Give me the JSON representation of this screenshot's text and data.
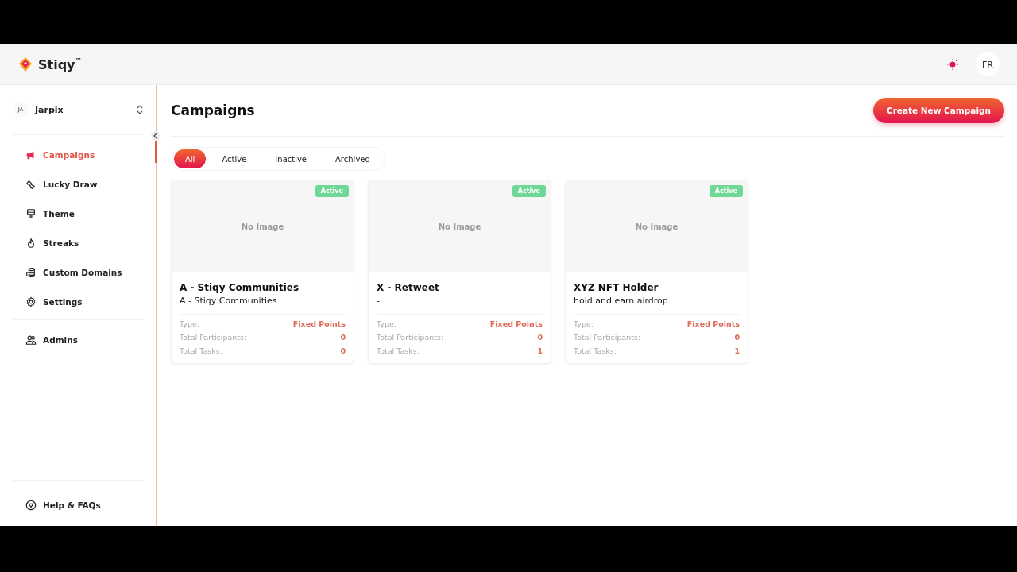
{
  "header": {
    "brand": "Stiqy",
    "trademark": "™",
    "language": "FR"
  },
  "sidebar": {
    "workspace": {
      "initials": "JA",
      "name": "Jarpix"
    },
    "items": [
      {
        "label": "Campaigns",
        "selected": true
      },
      {
        "label": "Lucky Draw",
        "selected": false
      },
      {
        "label": "Theme",
        "selected": false
      },
      {
        "label": "Streaks",
        "selected": false
      },
      {
        "label": "Custom Domains",
        "selected": false
      },
      {
        "label": "Settings",
        "selected": false
      },
      {
        "label": "Admins",
        "selected": false
      }
    ],
    "footer_item": {
      "label": "Help & FAQs"
    }
  },
  "page": {
    "title": "Campaigns",
    "create_button": "Create New Campaign",
    "filters": [
      {
        "label": "All",
        "selected": true
      },
      {
        "label": "Active",
        "selected": false
      },
      {
        "label": "Inactive",
        "selected": false
      },
      {
        "label": "Archived",
        "selected": false
      }
    ],
    "campaigns": [
      {
        "status": "Active",
        "image_placeholder": "No Image",
        "title": "A - Stiqy Communities",
        "description": "A - Stiqy Communities",
        "type_label": "Type:",
        "type": "Fixed Points",
        "participants_label": "Total Participants:",
        "participants": "0",
        "tasks_label": "Total Tasks:",
        "tasks": "0"
      },
      {
        "status": "Active",
        "image_placeholder": "No Image",
        "title": "X - Retweet",
        "description": "-",
        "type_label": "Type:",
        "type": "Fixed Points",
        "participants_label": "Total Participants:",
        "participants": "0",
        "tasks_label": "Total Tasks:",
        "tasks": "1"
      },
      {
        "status": "Active",
        "image_placeholder": "No Image",
        "title": "XYZ NFT Holder",
        "description": "hold and earn airdrop",
        "type_label": "Type:",
        "type": "Fixed Points",
        "participants_label": "Total Participants:",
        "participants": "0",
        "tasks_label": "Total Tasks:",
        "tasks": "1"
      }
    ]
  }
}
